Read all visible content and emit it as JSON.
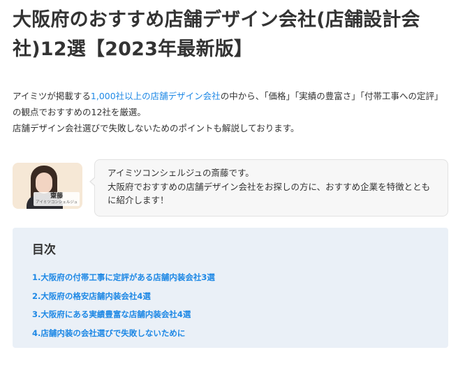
{
  "article": {
    "title": "大阪府のおすすめ店舗デザイン会社(店舗設計会社)12選【2023年最新版】",
    "intro": {
      "prefix": "アイミツが掲載する",
      "link_text": "1,000社以上の店舗デザイン会社",
      "suffix": "の中から、「価格」「実績の豊富さ」「付帯工事への定評」の観点でおすすめの12社を厳選。",
      "second_line": "店舗デザイン会社選びで失敗しないためのポイントも解説しております。"
    }
  },
  "concierge": {
    "avatar_name": "齋藤",
    "avatar_role": "アイミツコンシェルジュ",
    "message_line1": "アイミツコンシェルジュの斎藤です。",
    "message_line2": "大阪府でおすすめの店舗デザイン会社をお探しの方に、おすすめ企業を特徴とともに紹介します！"
  },
  "toc": {
    "title": "目次",
    "items": [
      "1.大阪府の付帯工事に定評がある店舗内装会社3選",
      "2.大阪府の格安店舗内装会社4選",
      "3.大阪府にある実績豊富な店舗内装会社4選",
      "4.店舗内装の会社選びで失敗しないために"
    ]
  },
  "colors": {
    "link": "#1e88e5",
    "toc_background": "#eaf0f7",
    "bubble_background": "#f7f7f7",
    "text": "#333333"
  },
  "icons": {
    "avatar": "concierge-portrait-photo"
  }
}
